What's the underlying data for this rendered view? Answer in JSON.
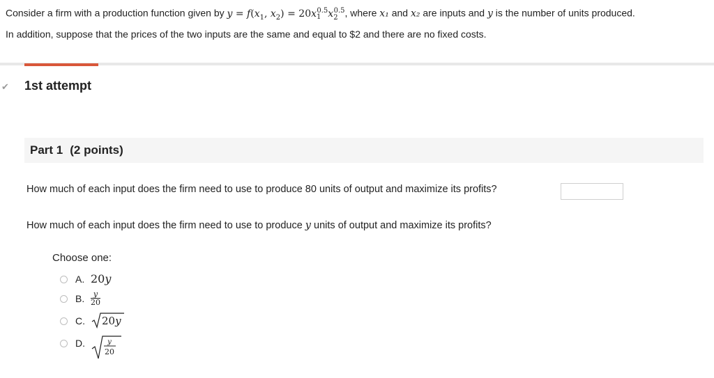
{
  "question": {
    "text_before": "Consider a firm with a production function given by",
    "formula_lhs": "y = f(x",
    "formula_full": "y = f(x₁, x₂) = 20x₁^0.5 x₂^0.5",
    "text_after": ", where",
    "x1": "x₁",
    "text_and": "and",
    "x2": "x₂",
    "text_inputs": "are inputs and",
    "y": "y",
    "text_end": "is the number of units produced.",
    "line2": "In addition, suppose that the prices of the two inputs are the same and equal to $2 and there are no fixed costs."
  },
  "attempt": {
    "title": "1st attempt"
  },
  "part": {
    "title": "Part 1",
    "points": "(2 points)"
  },
  "q1": {
    "text": "How much of each input does the firm need to use to produce 80 units of output and maximize its profits?",
    "answer_value": ""
  },
  "q2": {
    "text_before": "How much of each input does the firm need to use to produce",
    "var": "y",
    "text_after": "units of output and maximize its profits?"
  },
  "choices": {
    "label": "Choose one:",
    "options": [
      {
        "letter": "A.",
        "value": "20y"
      },
      {
        "letter": "B.",
        "value": "y/20"
      },
      {
        "letter": "C.",
        "value": "√20y"
      },
      {
        "letter": "D.",
        "value": "√(y/20)"
      }
    ]
  },
  "colors": {
    "accent": "#d9573a",
    "separator": "#e8e8e8",
    "part_header_bg": "#f5f5f5"
  }
}
